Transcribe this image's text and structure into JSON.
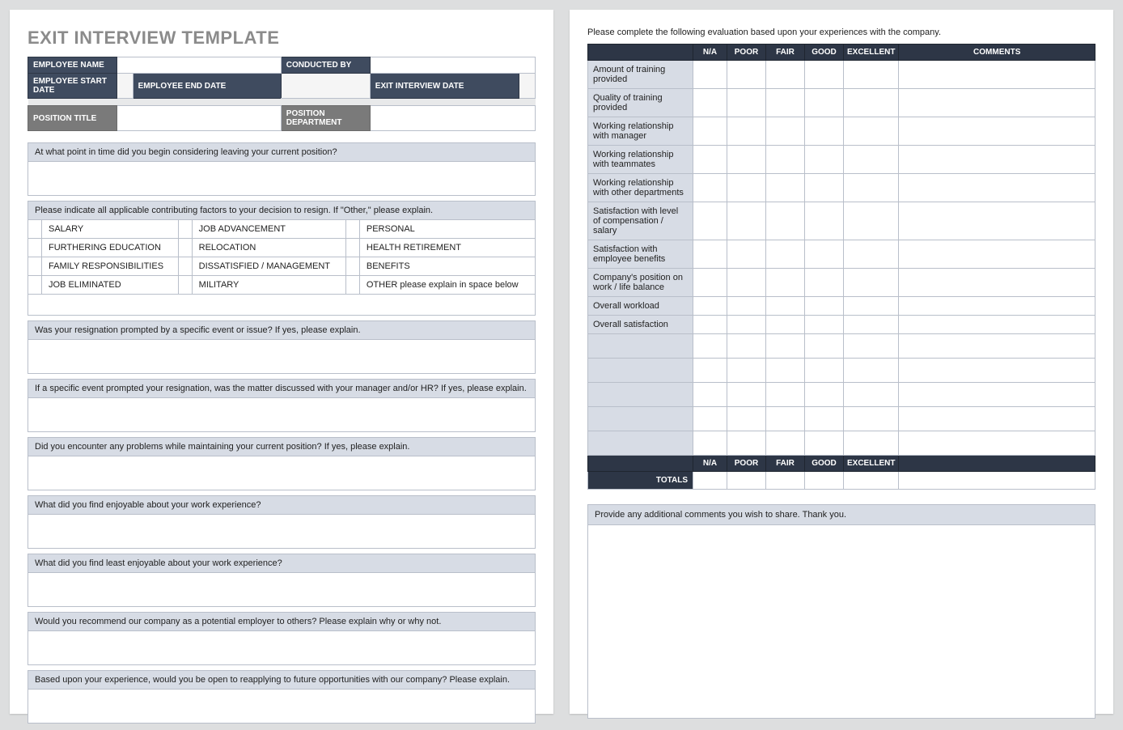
{
  "title": "EXIT INTERVIEW TEMPLATE",
  "header": {
    "employee_name": "EMPLOYEE NAME",
    "conducted_by": "CONDUCTED BY",
    "employee_start_date": "EMPLOYEE START DATE",
    "employee_end_date": "EMPLOYEE END DATE",
    "exit_interview_date": "EXIT INTERVIEW DATE",
    "position_title": "POSITION TITLE",
    "position_department": "POSITION DEPARTMENT"
  },
  "questions": {
    "q1": "At what point in time did you begin considering leaving your current position?",
    "factors_head": "Please indicate all applicable contributing factors to your decision to resign. If \"Other,\" please explain.",
    "q2": "Was your resignation prompted by a specific event or issue? If yes, please explain.",
    "q3": "If a specific event prompted your resignation, was the matter discussed with your manager and/or HR? If yes, please explain.",
    "q4": "Did you encounter any problems while maintaining your current position?  If yes, please explain.",
    "q5": "What did you find enjoyable about your work experience?",
    "q6": "What did you find least enjoyable about your work experience?",
    "q7": "Would you recommend our company as a potential employer to others? Please explain why or why not.",
    "q8": "Based upon your experience, would you be open to reapplying to future opportunities with our company?  Please explain."
  },
  "factors": {
    "r1c1": "SALARY",
    "r1c2": "JOB ADVANCEMENT",
    "r1c3": "PERSONAL",
    "r2c1": "FURTHERING EDUCATION",
    "r2c2": "RELOCATION",
    "r2c3": "HEALTH RETIREMENT",
    "r3c1": "FAMILY RESPONSIBILITIES",
    "r3c2": "DISSATISFIED / MANAGEMENT",
    "r3c3": "BENEFITS",
    "r4c1": "JOB ELIMINATED",
    "r4c2": "MILITARY",
    "r4c3": "OTHER please explain in space below"
  },
  "page2": {
    "instruction": "Please complete the following evaluation based upon your experiences with the company.",
    "headers": {
      "na": "N/A",
      "poor": "POOR",
      "fair": "FAIR",
      "good": "GOOD",
      "excellent": "EXCELLENT",
      "comments": "COMMENTS"
    },
    "rows": [
      "Amount of training provided",
      "Quality of training provided",
      "Working relationship with manager",
      "Working relationship with teammates",
      "Working relationship with other departments",
      "Satisfaction with level of compensation / salary",
      "Satisfaction with employee benefits",
      "Company's position on work / life balance",
      "Overall workload",
      "Overall satisfaction"
    ],
    "totals": "TOTALS",
    "additional": "Provide any additional comments you wish to share.  Thank you."
  }
}
